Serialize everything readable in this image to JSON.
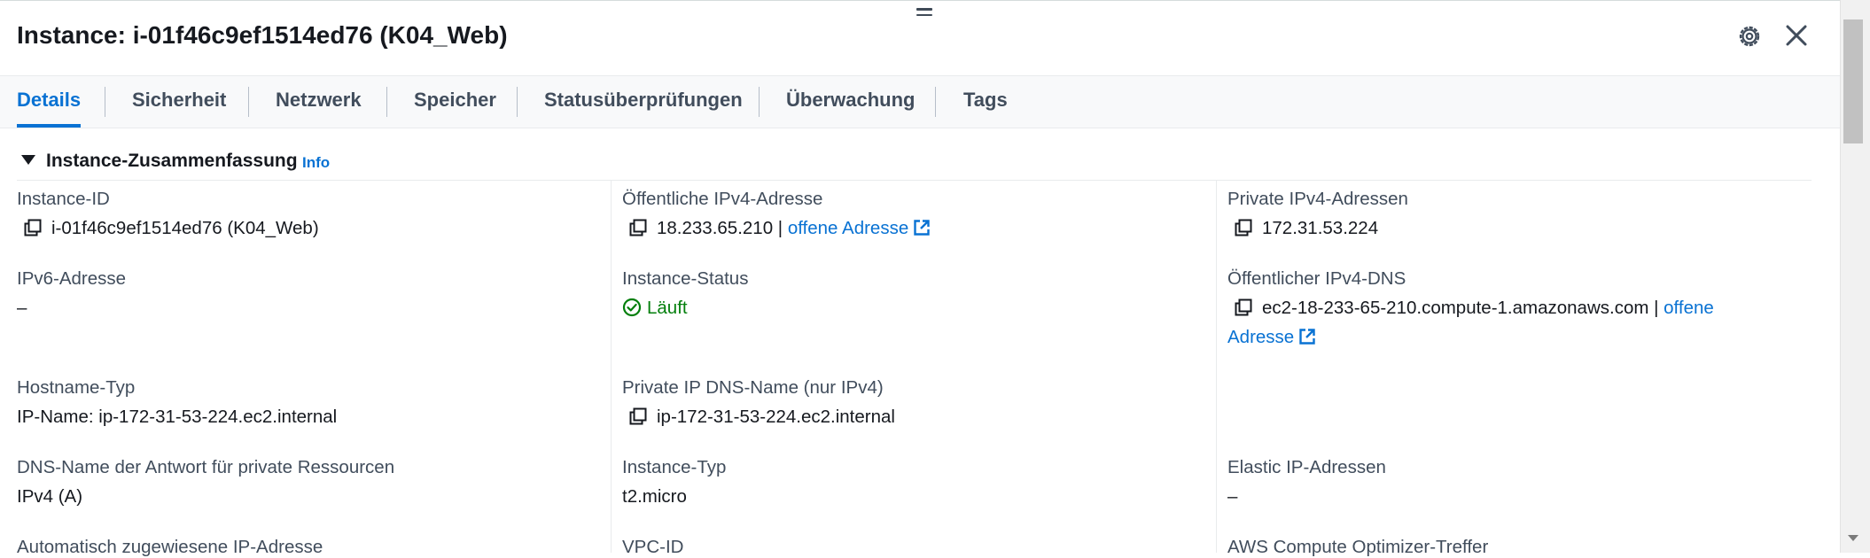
{
  "header": {
    "title": "Instance: i-01f46c9ef1514ed76 (K04_Web)",
    "settings_icon": "gear-icon",
    "close_icon": "close-icon"
  },
  "tabs": [
    {
      "label": "Details",
      "active": true
    },
    {
      "label": "Sicherheit",
      "active": false
    },
    {
      "label": "Netzwerk",
      "active": false
    },
    {
      "label": "Speicher",
      "active": false
    },
    {
      "label": "Statusüberprüfungen",
      "active": false
    },
    {
      "label": "Überwachung",
      "active": false
    },
    {
      "label": "Tags",
      "active": false
    }
  ],
  "section": {
    "title": "Instance-Zusammenfassung",
    "info": "Info"
  },
  "fields": {
    "instance_id": {
      "label": "Instance-ID",
      "value": "i-01f46c9ef1514ed76 (K04_Web)"
    },
    "public_ipv4": {
      "label": "Öffentliche IPv4-Adresse",
      "value": "18.233.65.210 |",
      "link": "offene Adresse"
    },
    "private_ipv4": {
      "label": "Private IPv4-Adressen",
      "value": "172.31.53.224"
    },
    "ipv6": {
      "label": "IPv6-Adresse",
      "value": "–"
    },
    "instance_status": {
      "label": "Instance-Status",
      "value": "Läuft"
    },
    "public_dns": {
      "label": "Öffentlicher IPv4-DNS",
      "value": "ec2-18-233-65-210.compute-1.amazonaws.com |",
      "link_part1": "offene",
      "link_part2": "Adresse"
    },
    "hostname_type": {
      "label": "Hostname-Typ",
      "value": "IP-Name: ip-172-31-53-224.ec2.internal"
    },
    "private_dns": {
      "label": "Private IP DNS-Name (nur IPv4)",
      "value": "ip-172-31-53-224.ec2.internal"
    },
    "dns_answer": {
      "label": "DNS-Name der Antwort für private Ressourcen",
      "value": "IPv4 (A)"
    },
    "instance_type": {
      "label": "Instance-Typ",
      "value": "t2.micro"
    },
    "elastic_ip": {
      "label": "Elastic IP-Adressen",
      "value": "–"
    },
    "auto_ip": {
      "label": "Automatisch zugewiesene IP-Adresse"
    },
    "vpc_id": {
      "label": "VPC-ID"
    },
    "optimizer": {
      "label": "AWS Compute Optimizer-Treffer"
    }
  },
  "colors": {
    "accent": "#0972d3",
    "success": "#037f0c",
    "text": "#16191f",
    "label": "#414d5c"
  }
}
